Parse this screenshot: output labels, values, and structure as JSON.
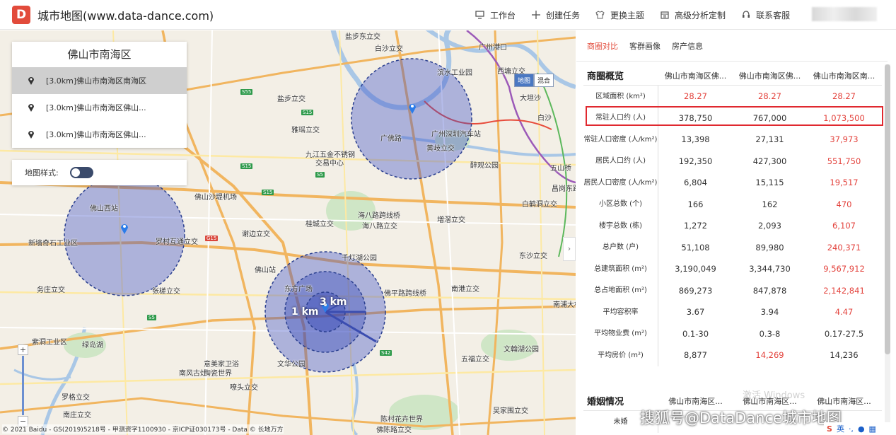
{
  "header": {
    "logo_letter": "D",
    "title": "城市地图(www.data-dance.com)",
    "nav": [
      {
        "label": "工作台",
        "icon": "monitor-icon"
      },
      {
        "label": "创建任务",
        "icon": "plus-icon"
      },
      {
        "label": "更换主题",
        "icon": "shirt-icon"
      },
      {
        "label": "高级分析定制",
        "icon": "calendar-icon"
      },
      {
        "label": "联系客服",
        "icon": "headset-icon"
      }
    ]
  },
  "map": {
    "panel_title": "佛山市南海区",
    "poi_items": [
      {
        "label": "[3.0km]佛山市南海区南海区"
      },
      {
        "label": "[3.0km]佛山市南海区佛山..."
      },
      {
        "label": "[3.0km]佛山市南海区佛山..."
      }
    ],
    "style_label": "地图样式:",
    "maptype": {
      "map": "地图",
      "hybrid": "混合"
    },
    "ring_labels": {
      "inner": "1 km",
      "outer": "3 km"
    },
    "copyright": "© 2021 Baidu - GS(2019)5218号 - 甲测资字1100930 - 京ICP证030173号 - Data © 长地万方",
    "places": [
      "盐步东立交",
      "盐步立交",
      "雅瑶立交",
      "九江五金不锈钢",
      "交易中心",
      "佛山沙堤机场",
      "佛山西站",
      "罗村互通立交",
      "新墙奇石工业区",
      "务庄立交",
      "张槎立交",
      "紫洞工业区",
      "绿岛湖",
      "佛山站",
      "东方广场",
      "佛山",
      "谢边立交",
      "桂城立交",
      "海八路跨线桥",
      "海八路立交",
      "千灯湖公园",
      "佛平路跨线桥",
      "广佛路",
      "广州深圳汽车站",
      "黄岐立交",
      "醉观公园",
      "増滘立交",
      "南港立交",
      "东沙立交",
      "文翰湖公园",
      "意美家卫浴",
      "陶瓷世界",
      "南风古灶",
      "文华公园",
      "嘹头立交",
      "罗格立交",
      "南庄立交",
      "陈村花卉世界",
      "吴家围立交",
      "佛陈路立交",
      "五福立交",
      "西塘立交",
      "白鹤洞立交",
      "昌岗东路",
      "南浦大桥",
      "五山桥",
      "滨水工业园",
      "白沙立交",
      "广州港口",
      "白沙",
      "大坦沙"
    ]
  },
  "right_panel": {
    "tabs": [
      "商圈对比",
      "客群画像",
      "房产信息"
    ],
    "section_title": "商圈概览",
    "columns": [
      "佛山市南海区佛...",
      "佛山市南海区佛...",
      "佛山市南海区南..."
    ],
    "rows": [
      {
        "label": "区域面积 (km²)",
        "values": [
          "28.27",
          "28.27",
          "28.27"
        ],
        "red": [
          true,
          true,
          true
        ]
      },
      {
        "label": "常驻人口约 (人)",
        "values": [
          "378,750",
          "767,000",
          "1,073,500"
        ],
        "red": [
          false,
          false,
          true
        ]
      },
      {
        "label": "常驻人口密度 (人/km²)",
        "values": [
          "13,398",
          "27,131",
          "37,973"
        ],
        "red": [
          false,
          false,
          true
        ]
      },
      {
        "label": "居民人口约 (人)",
        "values": [
          "192,350",
          "427,300",
          "551,750"
        ],
        "red": [
          false,
          false,
          true
        ]
      },
      {
        "label": "居民人口密度 (人/km²)",
        "values": [
          "6,804",
          "15,115",
          "19,517"
        ],
        "red": [
          false,
          false,
          true
        ]
      },
      {
        "label": "小区总数 (个)",
        "values": [
          "166",
          "162",
          "470"
        ],
        "red": [
          false,
          false,
          true
        ]
      },
      {
        "label": "楼宇总数 (栋)",
        "values": [
          "1,272",
          "2,093",
          "6,107"
        ],
        "red": [
          false,
          false,
          true
        ]
      },
      {
        "label": "总户数 (户)",
        "values": [
          "51,108",
          "89,980",
          "240,371"
        ],
        "red": [
          false,
          false,
          true
        ]
      },
      {
        "label": "总建筑面积 (m²)",
        "values": [
          "3,190,049",
          "3,344,730",
          "9,567,912"
        ],
        "red": [
          false,
          false,
          true
        ]
      },
      {
        "label": "总占地面积 (m²)",
        "values": [
          "869,273",
          "847,878",
          "2,142,841"
        ],
        "red": [
          false,
          false,
          true
        ]
      },
      {
        "label": "平均容积率",
        "values": [
          "3.67",
          "3.94",
          "4.47"
        ],
        "red": [
          false,
          false,
          true
        ]
      },
      {
        "label": "平均物业费 (m²)",
        "values": [
          "0.1-30",
          "0.3-8",
          "0.17-27.5"
        ],
        "red": [
          false,
          false,
          false
        ]
      },
      {
        "label": "平均房价 (m²)",
        "values": [
          "8,877",
          "14,269",
          "14,236"
        ],
        "red": [
          false,
          true,
          false
        ]
      }
    ],
    "section2_title": "婚姻情况",
    "section2_columns": [
      "佛山市南海区...",
      "佛山市南海区...",
      "佛山市南海区..."
    ],
    "section2_first_row": "未婚",
    "highlight_color": "#e0282f"
  },
  "overlay": {
    "windows_watermark": "激活 Windows",
    "sohu_watermark": "搜狐号@DataDance城市地图",
    "ime": "英"
  }
}
